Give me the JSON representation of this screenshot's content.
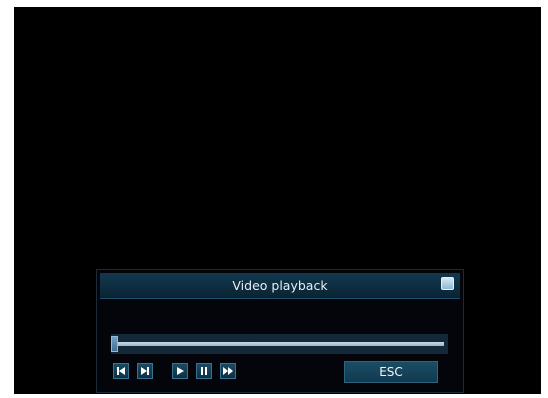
{
  "dialog": {
    "title": "Video playback"
  },
  "playback": {
    "progress": 0.0
  },
  "controls": {
    "buttons": [
      "skip-previous-icon",
      "skip-next-icon",
      "play-icon",
      "pause-icon",
      "fast-forward-icon"
    ],
    "esc_label": "ESC"
  },
  "colors": {
    "screen": "#000000",
    "titlebar": "#0d2c3f",
    "button": "#194a63",
    "track": "#13293a"
  }
}
